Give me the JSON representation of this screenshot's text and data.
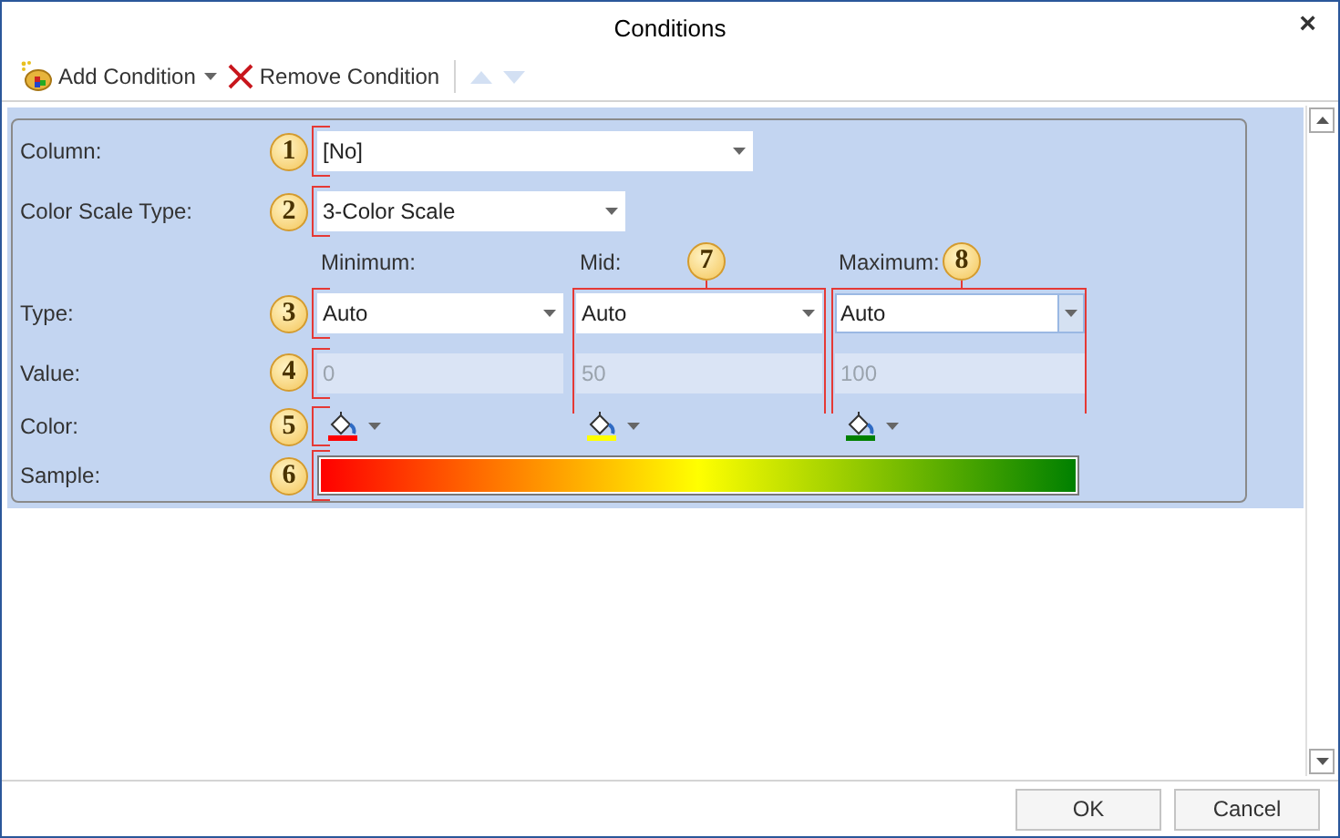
{
  "window": {
    "title": "Conditions",
    "close": "×"
  },
  "toolbar": [
    {
      "kind": "add",
      "label": "Add Condition",
      "dropdown": true,
      "disabled": false
    },
    {
      "kind": "remove",
      "label": "Remove Condition",
      "dropdown": false,
      "disabled": false
    },
    {
      "kind": "up",
      "disabled": true
    },
    {
      "kind": "down",
      "disabled": true
    }
  ],
  "form": {
    "column": {
      "label": "Column:",
      "callout": "1",
      "value": "[No]"
    },
    "scale_type": {
      "label": "Color Scale Type:",
      "callout": "2",
      "value": "3-Color Scale"
    },
    "type_row": {
      "label": "Type:",
      "callout": "3"
    },
    "value_row": {
      "label": "Value:",
      "callout": "4"
    },
    "color_row": {
      "label": "Color:",
      "callout": "5"
    },
    "sample_row": {
      "label": "Sample:",
      "callout": "6"
    },
    "points": [
      {
        "header": "Minimum:",
        "type": "Auto",
        "value": "0",
        "disabled": true,
        "color": "#ff0000",
        "focused": false
      },
      {
        "header": "Mid:",
        "callout": "7",
        "type": "Auto",
        "value": "50",
        "disabled": true,
        "color": "#ffff00",
        "focused": false
      },
      {
        "header": "Maximum:",
        "callout": "8",
        "type": "Auto",
        "value": "100",
        "disabled": true,
        "color": "#008000",
        "focused": true
      }
    ]
  },
  "buttons": [
    {
      "label": "OK"
    },
    {
      "label": "Cancel"
    }
  ]
}
